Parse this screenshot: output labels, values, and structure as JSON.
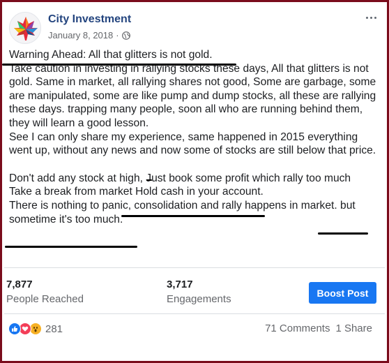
{
  "post": {
    "page_name": "City Investment",
    "date": "January 8, 2018",
    "meta_separator": "·",
    "privacy_icon": "globe-icon",
    "avatar_icon": "maple-leaf-logo-icon",
    "more_icon": "more-options-icon"
  },
  "body": {
    "line_warning": "Warning Ahead: All that glitters is not gold.",
    "paragraph_caution": "Take caution in investing in rallying stocks these days, All that glitters is not gold. Same in market, all rallying shares not good, Some are garbage, some are manipulated, some are like pump and dump stocks, all these are rallying these days. trapping many people, soon all who are running behind them, they will learn a good lesson.",
    "paragraph_experience": "See I can only share my experience, same happened in 2015 everything went up, without any news and now some of stocks are still below that price.",
    "line_dont_add": "Don't add any stock at high, Just book some profit which rally too much",
    "line_take_break": "Take a break from market Hold cash in your account.",
    "line_nothing_panic": "There is nothing to panic, consolidation and rally happens in market. but sometime it's too much."
  },
  "stats": {
    "people_reached_value": "7,877",
    "people_reached_label": "People Reached",
    "engagements_value": "3,717",
    "engagements_label": "Engagements",
    "boost_label": "Boost Post"
  },
  "reactions": {
    "icons": [
      "like-icon",
      "love-icon",
      "wow-icon"
    ],
    "count": "281",
    "comments": "71 Comments",
    "shares": "1 Share"
  },
  "colors": {
    "frame": "#7a0c1c",
    "page_name": "#24457f",
    "boost": "#1877f2",
    "like": "#1877f2",
    "love": "#f33e58",
    "wow": "#f7b125"
  }
}
